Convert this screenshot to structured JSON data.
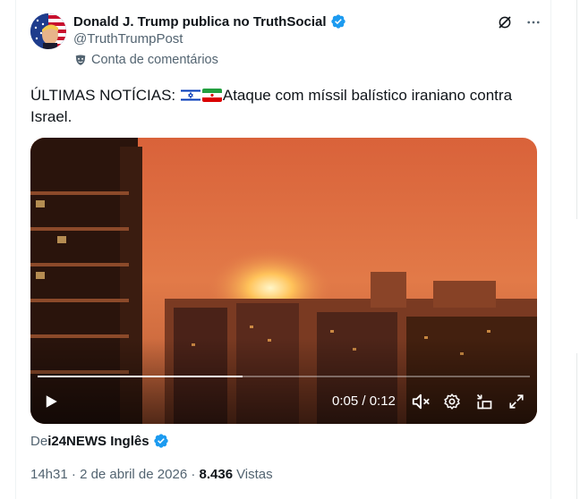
{
  "author": {
    "display_name": "Donald J. Trump publica no TruthSocial",
    "handle": "@TruthTrumpPost",
    "verified": true
  },
  "community_label": "Conta de comentários",
  "tweet": {
    "text_prefix": "ÚLTIMAS NOTÍCIAS: ",
    "flags": [
      "israel-flag",
      "iran-flag"
    ],
    "text_body": "Ataque com míssil balístico iraniano contra Israel."
  },
  "video": {
    "current_time": "0:05",
    "duration": "0:12",
    "time_display": "0:05 / 0:12",
    "progress": 0.4167
  },
  "source": {
    "prefix": "De",
    "name": "i24NEWS Inglês",
    "verified": true
  },
  "meta": {
    "time": "14h31",
    "separator": " · ",
    "date": "2 de abril de 2026",
    "views_count": "8.436",
    "views_label": "Vistas"
  },
  "colors": {
    "text_primary": "#0f1419",
    "text_secondary": "#536471",
    "verified_blue": "#1d9bf0"
  }
}
